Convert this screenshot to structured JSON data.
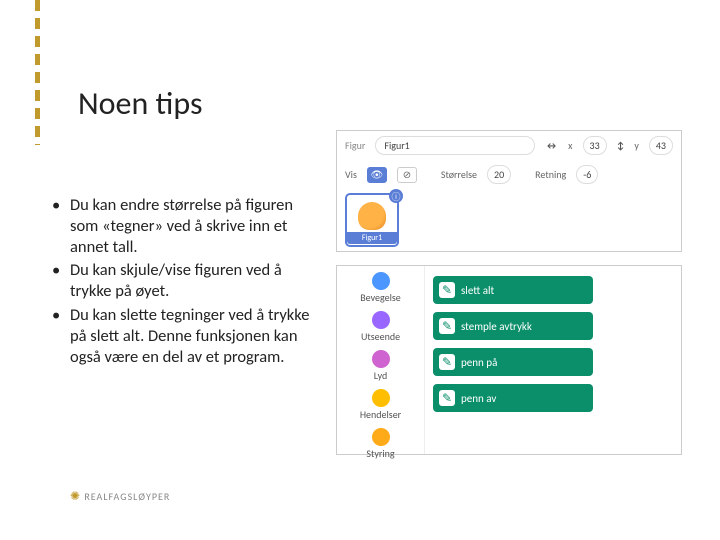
{
  "title": "Noen tips",
  "bullets": [
    "Du kan endre størrelse på figuren som «tegner» ved å skrive inn et annet tall.",
    "Du kan skjule/vise figuren ved å trykke på øyet.",
    "Du kan slette tegninger ved å trykke på slett alt. Denne funksjonen kan også være en del av et program."
  ],
  "logo_text": "REALFAGSLØYPER",
  "sprite_panel": {
    "label_figur": "Figur",
    "name_value": "Figur1",
    "x_label": "x",
    "x_value": "33",
    "y_label": "y",
    "y_value": "43",
    "vis_label": "Vis",
    "size_label": "Størrelse",
    "size_value": "20",
    "dir_label": "Retning",
    "dir_value": "-6",
    "thumb_label": "Figur1"
  },
  "categories": [
    {
      "label": "Bevegelse",
      "color": "#4c97ff"
    },
    {
      "label": "Utseende",
      "color": "#9966ff"
    },
    {
      "label": "Lyd",
      "color": "#cf63cf"
    },
    {
      "label": "Hendelser",
      "color": "#ffbf00"
    },
    {
      "label": "Styring",
      "color": "#ffab19"
    }
  ],
  "blocks": [
    "slett alt",
    "stemple avtrykk",
    "penn på",
    "penn av"
  ]
}
